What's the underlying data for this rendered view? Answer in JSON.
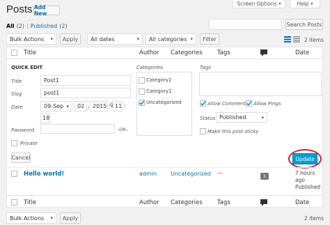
{
  "page": {
    "title": "Posts",
    "add_new": "Add New"
  },
  "screen_options": {
    "label": "Screen Options",
    "help": "Help"
  },
  "filters": {
    "all": "All",
    "all_count": "(2)",
    "sep": "|",
    "published": "Published",
    "published_count": "(2)"
  },
  "search": {
    "value": "",
    "button": "Search Posts"
  },
  "toolbar": {
    "bulk_actions": "Bulk Actions",
    "apply": "Apply",
    "dates": "All dates",
    "categories": "All categories",
    "filter": "Filter",
    "items_count": "2 items"
  },
  "columns": {
    "title": "Title",
    "author": "Author",
    "categories": "Categories",
    "tags": "Tags",
    "date": "Date"
  },
  "quick_edit": {
    "heading": "QUICK EDIT",
    "title_label": "Title",
    "title_value": "Post1",
    "slug_label": "Slug",
    "slug_value": "post1",
    "date_label": "Date",
    "date_month": "09-Sep",
    "date_day": "02",
    "date_year": "2015",
    "date_at": "@",
    "date_hour": "11",
    "date_min": "18",
    "date_comma": ",",
    "date_colon": ":",
    "password_label": "Password",
    "password_value": "",
    "or_label": "–OR–",
    "private_label": "Private",
    "categories_label": "Categories",
    "categories": [
      {
        "label": "Category2",
        "checked": false
      },
      {
        "label": "Category1",
        "checked": false
      },
      {
        "label": "Uncategorized",
        "checked": true
      }
    ],
    "tags_label": "Tags",
    "allow_comments": "Allow Comments",
    "allow_pings": "Allow Pings",
    "status_label": "Status",
    "status_value": "Published",
    "sticky_label": "Make this post sticky",
    "cancel": "Cancel",
    "update": "Update"
  },
  "posts": [
    {
      "title": "Hello world!",
      "author": "admin",
      "categories": "Uncategorized",
      "tags": "—",
      "comments": "1",
      "date_line1": "7 hours",
      "date_line2": "ago",
      "date_line3": "Published"
    }
  ],
  "colors": {
    "accent": "#0073aa",
    "update_button": "#00a0d2",
    "highlight_circle": "#c0272d"
  },
  "icons": {
    "comments": "comment-bubble-icon",
    "list_view": "list-view-icon",
    "excerpt_view": "excerpt-view-icon"
  }
}
